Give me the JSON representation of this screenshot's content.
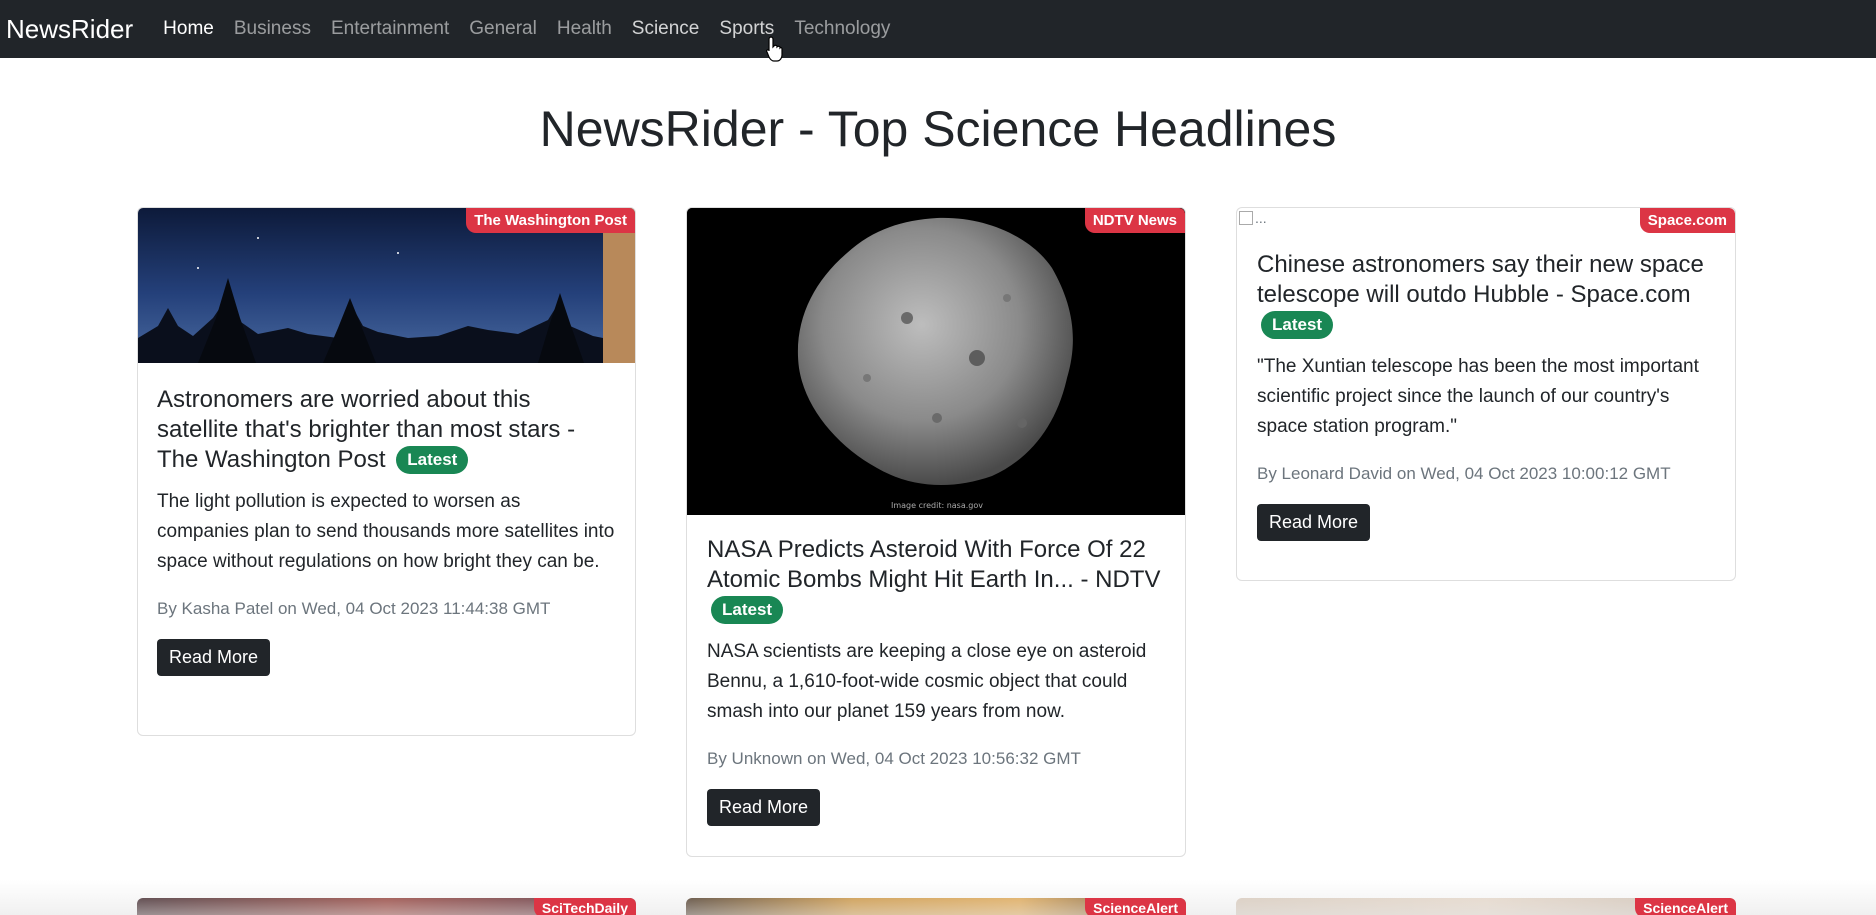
{
  "navbar": {
    "brand": "NewsRider",
    "links": [
      "Home",
      "Business",
      "Entertainment",
      "General",
      "Health",
      "Science",
      "Sports",
      "Technology"
    ]
  },
  "page_title": "NewsRider - Top Science Headlines",
  "latest_label": "Latest",
  "read_more_label": "Read More",
  "articles": [
    {
      "source": "The Washington Post",
      "title": "Astronomers are worried about this satellite that's brighter than most stars - The Washington Post",
      "description": "The light pollution is expected to worsen as companies plan to send thousands more satellites into space without regulations on how bright they can be.",
      "meta": "By Kasha Patel on Wed, 04 Oct 2023 11:44:38 GMT"
    },
    {
      "source": "NDTV News",
      "title": "NASA Predicts Asteroid With Force Of 22 Atomic Bombs Might Hit Earth In... - NDTV",
      "description": "NASA scientists are keeping a close eye on asteroid Bennu, a 1,610-foot-wide cosmic object that could smash into our planet 159 years from now.",
      "meta": "By Unknown on Wed, 04 Oct 2023 10:56:32 GMT",
      "image_caption": "Image credit: nasa.gov"
    },
    {
      "source": "Space.com",
      "image_alt": "...",
      "title": "Chinese astronomers say their new space telescope will outdo Hubble - Space.com",
      "description": "\"The Xuntian telescope has been the most important scientific project since the launch of our country's space station program.\"",
      "meta": "By Leonard David on Wed, 04 Oct 2023 10:00:12 GMT"
    }
  ],
  "next_row_sources": [
    "SciTechDaily",
    "ScienceAlert",
    "ScienceAlert"
  ],
  "colors": {
    "navbar": "#212529",
    "source_badge": "#dc3545",
    "latest_badge": "#198754",
    "button": "#212529"
  }
}
